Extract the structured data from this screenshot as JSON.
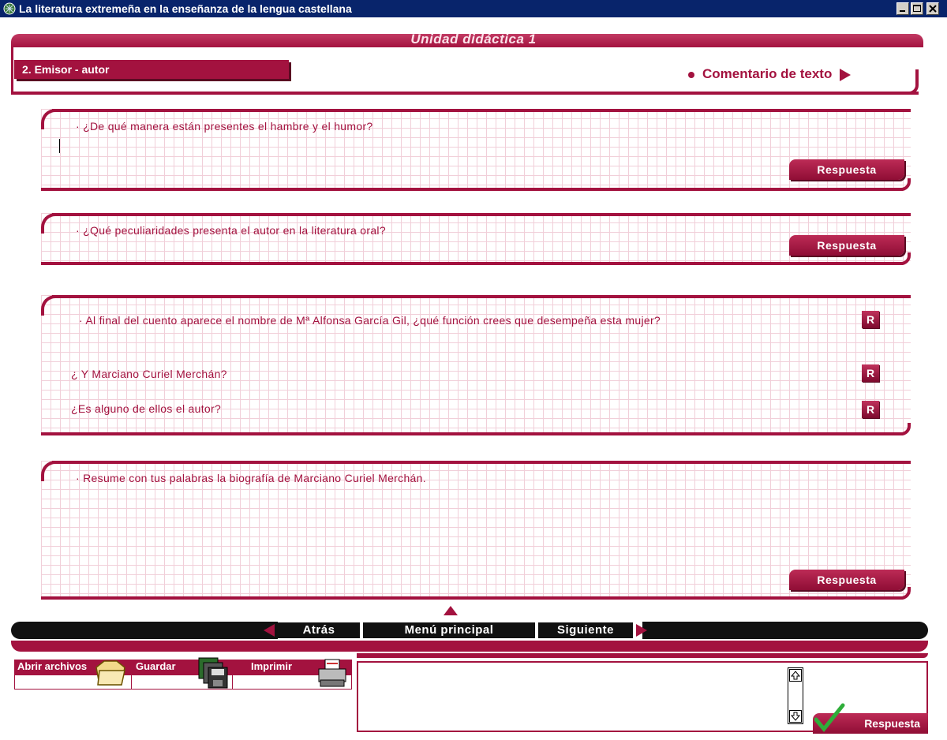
{
  "window": {
    "title": "La literatura extremeña en la enseñanza de la lengua castellana",
    "icon": "app-grid-icon"
  },
  "header": {
    "unit_title": "Unidad didáctica 1",
    "section": "2. Emisor - autor",
    "link": "Comentario de texto"
  },
  "panels": [
    {
      "question": "· ¿De qué manera están presentes el hambre y el humor?",
      "button": "Respuesta"
    },
    {
      "question": "· ¿Qué peculiaridades presenta  el autor en la literatura oral?",
      "button": "Respuesta"
    },
    {
      "items": [
        {
          "question": "· Al final del cuento aparece el nombre de Mª Alfonsa García Gil, ¿qué función crees que desempeña esta mujer?",
          "button": "R"
        },
        {
          "question": "¿ Y Marciano Curiel Merchán?",
          "button": "R"
        },
        {
          "question": "¿Es alguno de ellos el autor?",
          "button": "R"
        }
      ]
    },
    {
      "question": "· Resume con tus palabras la biografía de Marciano Curiel Merchán.",
      "button": "Respuesta"
    }
  ],
  "nav": {
    "back": "Atrás",
    "menu": "Menú principal",
    "next": "Siguiente"
  },
  "file_toolbar": {
    "open": "Abrir archivos",
    "save": "Guardar",
    "print": "Imprimir"
  },
  "answer_area": {
    "button": "Respuesta"
  },
  "colors": {
    "accent": "#a3123f",
    "titlebar": "#08246b",
    "grid": "#f1cfd9"
  }
}
